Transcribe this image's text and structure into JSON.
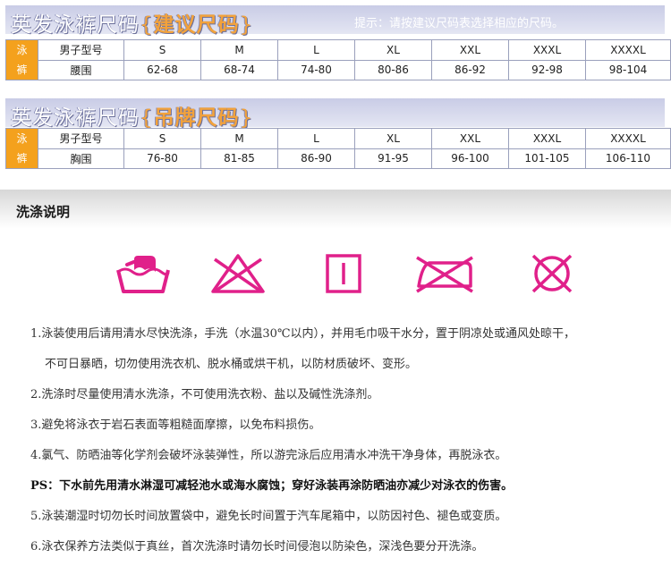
{
  "suggested": {
    "title": "英发泳裤尺码",
    "brace_open": "{",
    "highlight": "建议尺码",
    "brace_close": "}",
    "tip": "提示：请按建议尺码表选择相应的尺码。",
    "side_label": [
      "泳",
      "裤"
    ],
    "row1_label": "男子型号",
    "row2_label": "腰围",
    "sizes": [
      "S",
      "M",
      "L",
      "XL",
      "XXL",
      "XXXL",
      "XXXXL"
    ],
    "values": [
      "62-68",
      "68-74",
      "74-80",
      "80-86",
      "86-92",
      "92-98",
      "98-104"
    ]
  },
  "tag": {
    "title": "英发泳裤尺码",
    "brace_open": "{",
    "highlight": "吊牌尺码",
    "brace_close": "}",
    "side_label": [
      "泳",
      "裤"
    ],
    "row1_label": "男子型号",
    "row2_label": "胸围",
    "sizes": [
      "S",
      "M",
      "L",
      "XL",
      "XXL",
      "XXXL",
      "XXXXL"
    ],
    "values": [
      "76-80",
      "81-85",
      "86-90",
      "91-95",
      "96-100",
      "101-105",
      "106-110"
    ]
  },
  "wash": {
    "title": "洗涤说明",
    "icons": [
      "hand-wash-icon",
      "no-bleach-icon",
      "line-dry-icon",
      "no-iron-icon",
      "no-dry-clean-icon"
    ],
    "accent_color": "#e0208a",
    "notes": [
      "1.泳装使用后请用清水尽快洗涤，手洗（水温30℃以内），并用毛巾吸干水分，置于阴凉处或通风处晾干，",
      "不可日暴晒，切勿使用洗衣机、脱水桶或烘干机，以防材质破坏、变形。",
      "2.洗涤时尽量使用清水洗涤，不可使用洗衣粉、盐以及碱性洗涤剂。",
      "3.避免将泳衣于岩石表面等粗糙面摩擦，以免布料损伤。",
      "4.氯气、防晒油等化学剂会破坏泳装弹性，所以游完泳后应用清水冲洗干净身体，再脱泳衣。",
      "PS：下水前先用清水淋湿可减轻池水或海水腐蚀；穿好泳装再涂防晒油亦减少对泳衣的伤害。",
      "5.泳装潮湿时切勿长时间放置袋中，避免长时间置于汽车尾箱中，以防因衬色、褪色或变质。",
      "6.泳衣保养方法类似于真丝，首次洗涤时请勿长时间侵泡以防染色，深浅色要分开洗涤。"
    ]
  }
}
